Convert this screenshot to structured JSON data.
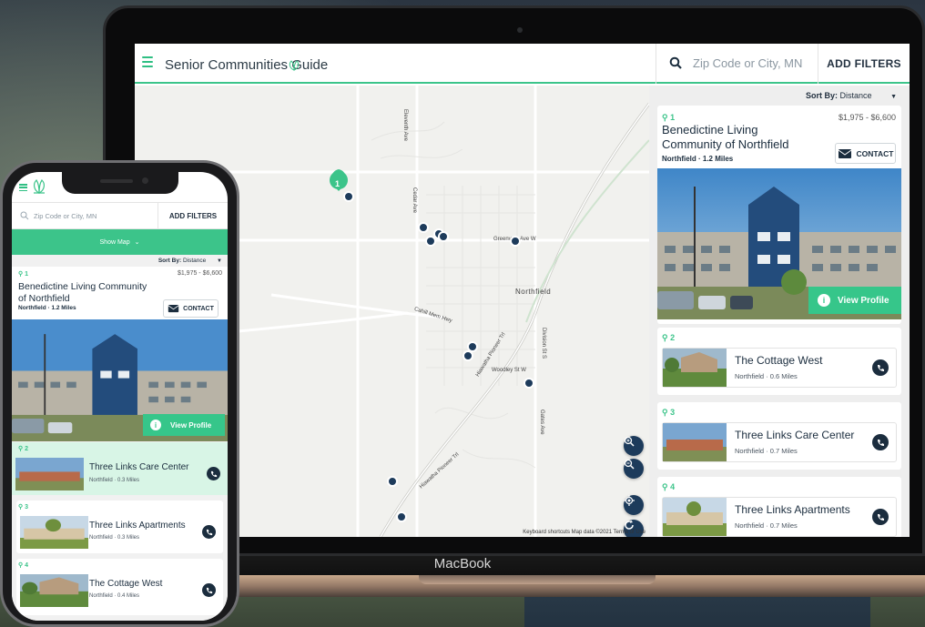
{
  "desktop": {
    "brand": "Senior Communities Guide",
    "search_placeholder": "Zip Code or City, MN",
    "filters_label": "ADD FILTERS",
    "sort_label": "Sort By:",
    "sort_value": "Distance",
    "map": {
      "cluster_count": "1",
      "labels": {
        "town": "Northfield",
        "road1": "Greenvale Ave W",
        "road2": "Woodley St W",
        "road3": "Cedar Ave",
        "road4": "Division St S",
        "road5": "Gates Ave",
        "road6": "Hiawatha Pioneer Trl",
        "road7": "Hiawatha Pioneer Trl",
        "road8": "Cahill Mem Hwy",
        "road9": "Eleventh Ave"
      },
      "footer": "Keyboard shortcuts   Map data ©2021   Terms of Use"
    },
    "featured": {
      "rank": "1",
      "price": "$1,975 - $6,600",
      "name": "Benedictine Living Community of Northfield",
      "location": "Northfield · 1.2 Miles",
      "contact_label": "CONTACT",
      "view_label": "View Profile"
    },
    "listings": [
      {
        "rank": "2",
        "name": "The Cottage West",
        "location": "Northfield · 0.6 Miles"
      },
      {
        "rank": "3",
        "name": "Three Links Care Center",
        "location": "Northfield · 0.7 Miles"
      },
      {
        "rank": "4",
        "name": "Three Links Apartments",
        "location": "Northfield · 0.7 Miles"
      }
    ],
    "device_label": "MacBook"
  },
  "mobile": {
    "search_placeholder": "Zip Code or City, MN",
    "filters_label": "ADD FILTERS",
    "show_map": "Show Map",
    "sort_label": "Sort By:",
    "sort_value": "Distance",
    "featured": {
      "rank": "1",
      "price": "$1,975 - $6,600",
      "name": "Benedictine Living Community of Northfield",
      "location": "Northfield · 1.2 Miles",
      "contact_label": "CONTACT",
      "view_label": "View Profile"
    },
    "listings": [
      {
        "rank": "2",
        "name": "Three Links Care Center",
        "location": "Northfield · 0.3 Miles"
      },
      {
        "rank": "3",
        "name": "Three Links Apartments",
        "location": "Northfield · 0.3 Miles"
      },
      {
        "rank": "4",
        "name": "The Cottage West",
        "location": "Northfield · 0.4 Miles"
      }
    ]
  },
  "colors": {
    "accent": "#3cc48a",
    "navy": "#1b2d3e",
    "marker": "#1d3b5b"
  }
}
